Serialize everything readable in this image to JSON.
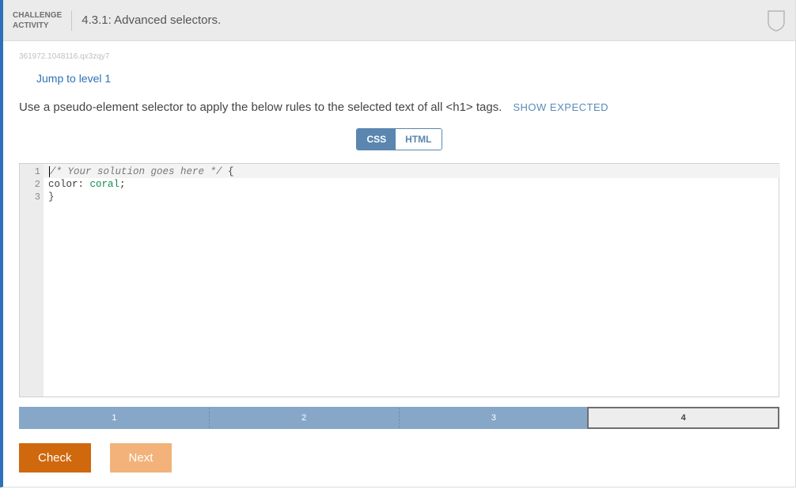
{
  "header": {
    "badge_line1": "CHALLENGE",
    "badge_line2": "ACTIVITY",
    "title": "4.3.1: Advanced selectors."
  },
  "ref_id": "361972.1048116.qx3zqy7",
  "jump_link": "Jump to level 1",
  "instruction": "Use a pseudo-element selector to apply the below rules to the selected text of all <h1> tags.",
  "show_expected": "SHOW EXPECTED",
  "tabs": {
    "css": "CSS",
    "html": "HTML",
    "active": "css"
  },
  "code": {
    "lines": [
      "1",
      "2",
      "3"
    ],
    "l1_comment": "/* Your solution goes here */",
    "l1_brace": " {",
    "l2_indent": "   ",
    "l2_prop": "color:",
    "l2_val": " coral",
    "l2_semi": ";",
    "l3": "}"
  },
  "progress": {
    "s1": "1",
    "s2": "2",
    "s3": "3",
    "s4": "4"
  },
  "buttons": {
    "check": "Check",
    "next": "Next"
  },
  "sidebar": {
    "items": [
      {
        "done": true,
        "label": "1"
      },
      {
        "done": true,
        "label": "2"
      },
      {
        "done": true,
        "label": "3"
      },
      {
        "done": false,
        "label": "4"
      }
    ]
  }
}
